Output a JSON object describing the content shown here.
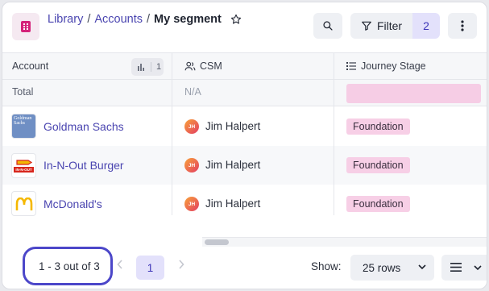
{
  "breadcrumb": {
    "library": "Library",
    "accounts": "Accounts",
    "separator": "/",
    "current": "My segment"
  },
  "toolbar": {
    "filter_label": "Filter",
    "filter_count": "2"
  },
  "table": {
    "columns": [
      {
        "label": "Account",
        "sort_count": "1"
      },
      {
        "label": "CSM"
      },
      {
        "label": "Journey Stage"
      }
    ],
    "total_row": {
      "label": "Total",
      "csm": "N/A"
    },
    "rows": [
      {
        "account": "Goldman Sachs",
        "logo_text": "Goldman Sachs",
        "csm_initials": "JH",
        "csm": "Jim Halpert",
        "stage": "Foundation"
      },
      {
        "account": "In-N-Out Burger",
        "logo_text": "IN-N-OUT",
        "csm_initials": "JH",
        "csm": "Jim Halpert",
        "stage": "Foundation"
      },
      {
        "account": "McDonald's",
        "csm_initials": "JH",
        "csm": "Jim Halpert",
        "stage": "Foundation"
      }
    ]
  },
  "pagination": {
    "range": "1 - 3 out of 3",
    "current_page": "1",
    "show_label": "Show:",
    "rows_per_page": "25 rows"
  },
  "colors": {
    "accent": "#4c47c9",
    "link": "#4a45b0",
    "stage_badge": "#f7cfe6",
    "app_icon": "#d4237a"
  }
}
